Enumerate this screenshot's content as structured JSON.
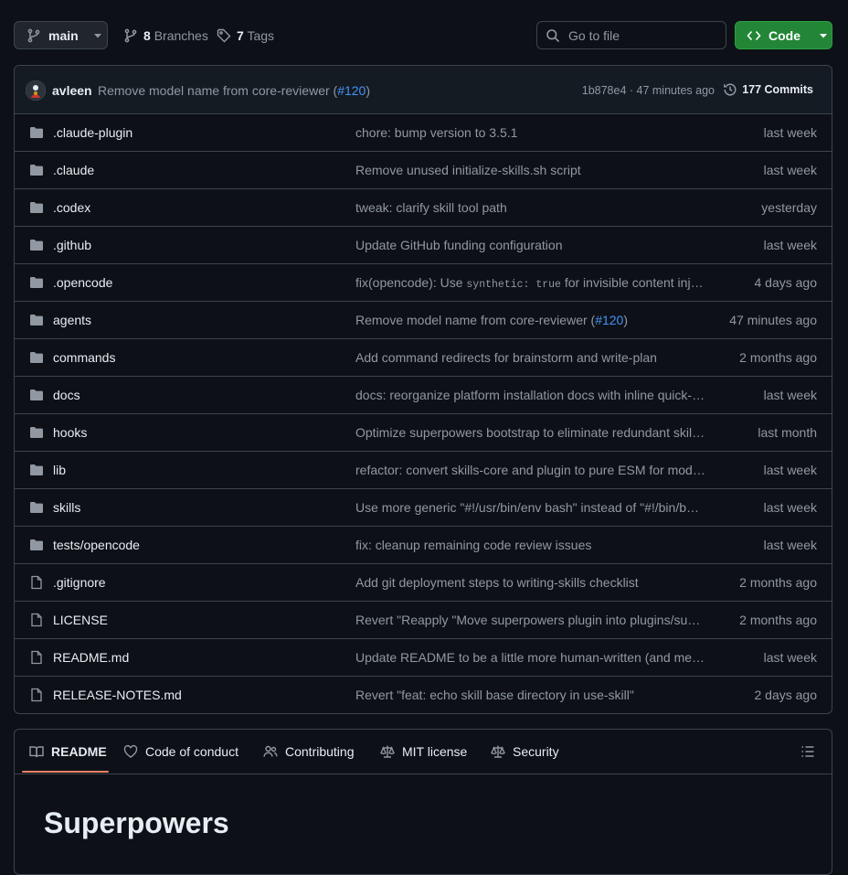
{
  "toolbar": {
    "branch": "main",
    "branches_count": "8",
    "branches_label": "Branches",
    "tags_count": "7",
    "tags_label": "Tags",
    "search_placeholder": "Go to file",
    "code_label": "Code"
  },
  "latest_commit": {
    "author": "avleen",
    "message": "Remove model name from core-reviewer (",
    "pr": "#120",
    "message_end": ")",
    "sha_time": "1b878e4 · 47 minutes ago",
    "commits_label": "177 Commits"
  },
  "files": [
    {
      "type": "dir",
      "name": ".claude-plugin",
      "message": "chore: bump version to 3.5.1",
      "time": "last week"
    },
    {
      "type": "dir",
      "name": ".claude",
      "message": "Remove unused initialize-skills.sh script",
      "time": "last week"
    },
    {
      "type": "dir",
      "name": ".codex",
      "message": "tweak: clarify skill tool path",
      "time": "yesterday"
    },
    {
      "type": "dir",
      "name": ".github",
      "message": "Update GitHub funding configuration",
      "time": "last week"
    },
    {
      "type": "dir",
      "name": ".opencode",
      "message_pre": "fix(opencode): Use ",
      "message_code": "synthetic: true",
      "message_post": " for invisible content inje…",
      "time": "4 days ago"
    },
    {
      "type": "dir",
      "name": "agents",
      "message": "Remove model name from core-reviewer (",
      "message_pr": "#120",
      "message_end": ")",
      "time": "47 minutes ago"
    },
    {
      "type": "dir",
      "name": "commands",
      "message": "Add command redirects for brainstorm and write-plan",
      "time": "2 months ago"
    },
    {
      "type": "dir",
      "name": "docs",
      "message": "docs: reorganize platform installation docs with inline quick-…",
      "time": "last week"
    },
    {
      "type": "dir",
      "name": "hooks",
      "message": "Optimize superpowers bootstrap to eliminate redundant skil…",
      "time": "last month"
    },
    {
      "type": "dir",
      "name": "lib",
      "message": "refactor: convert skills-core and plugin to pure ESM for mod…",
      "time": "last week"
    },
    {
      "type": "dir",
      "name": "skills",
      "message": "Use more generic \"#!/usr/bin/env bash\" instead of \"#!/bin/b…",
      "time": "last week"
    },
    {
      "type": "dir",
      "name": "tests/opencode",
      "message": "fix: cleanup remaining code review issues",
      "time": "last week"
    },
    {
      "type": "file",
      "name": ".gitignore",
      "message": "Add git deployment steps to writing-skills checklist",
      "time": "2 months ago"
    },
    {
      "type": "file",
      "name": "LICENSE",
      "message": "Revert \"Reapply \"Move superpowers plugin into plugins/sup…",
      "time": "2 months ago"
    },
    {
      "type": "file",
      "name": "README.md",
      "message": "Update README to be a little more human-written (and me…",
      "time": "last week"
    },
    {
      "type": "file",
      "name": "RELEASE-NOTES.md",
      "message": "Revert \"feat: echo skill base directory in use-skill\"",
      "time": "2 days ago"
    }
  ],
  "readme": {
    "tabs": [
      "README",
      "Code of conduct",
      "Contributing",
      "MIT license",
      "Security"
    ],
    "title": "Superpowers"
  },
  "colors": {
    "accent_green": "#238636",
    "link_blue": "#4493f8",
    "underline": "#f78166",
    "background": "#0d1117"
  }
}
